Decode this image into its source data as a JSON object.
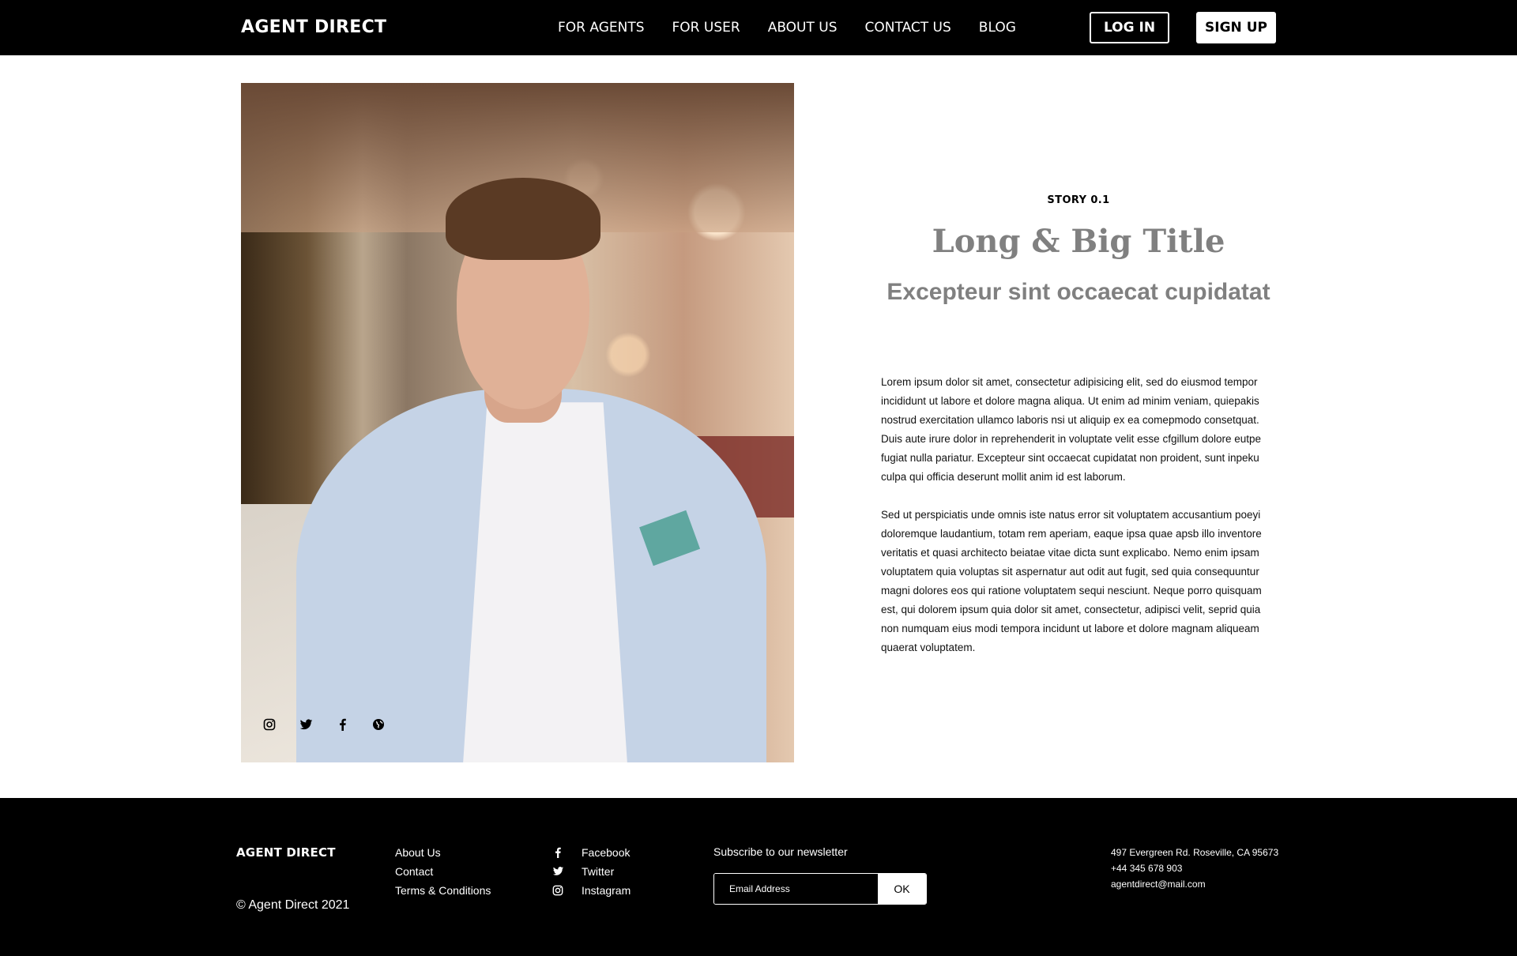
{
  "nav": {
    "brand": "AGENT DIRECT",
    "links": [
      "FOR AGENTS",
      "FOR USER",
      "ABOUT US",
      "CONTACT US",
      "BLOG"
    ],
    "login": "LOG IN",
    "signup": "SIGN UP"
  },
  "hero": {
    "social_icons": [
      "instagram-icon",
      "twitter-icon",
      "facebook-icon",
      "globe-icon"
    ]
  },
  "story": {
    "kicker": "STORY 0.1",
    "title": "Long & Big Title",
    "subtitle": "Excepteur sint occaecat cupidatat",
    "paragraphs": [
      "Lorem ipsum dolor sit amet, consectetur adipisicing elit, sed do eiusmod tempor incididunt ut labore et dolore magna aliqua. Ut enim ad minim veniam, quiepakis nostrud exercitation ullamco laboris nsi ut aliquip ex ea comepmodo consetquat. Duis aute irure dolor in reprehenderit in voluptate velit esse cfgillum dolore eutpe fugiat nulla pariatur. Excepteur sint occaecat cupidatat non proident, sunt inpeku culpa qui officia deserunt mollit anim id est laborum.",
      "Sed ut perspiciatis unde omnis iste natus error sit voluptatem accusantium poeyi doloremque laudantium, totam rem aperiam, eaque ipsa quae apsb illo inventore veritatis et quasi architecto beiatae vitae dicta sunt explicabo. Nemo enim ipsam voluptatem quia voluptas sit aspernatur aut odit aut fugit, sed quia consequuntur magni dolores eos qui ratione voluptatem sequi nesciunt. Neque porro quisquam est, qui dolorem ipsum quia dolor sit amet, consectetur, adipisci velit, seprid quia non numquam eius modi tempora incidunt ut labore et dolore magnam aliqueam quaerat voluptatem."
    ]
  },
  "footer": {
    "brand": "AGENT DIRECT",
    "copyright": "© Agent Direct 2021",
    "links": [
      "About Us",
      "Contact",
      "Terms & Conditions"
    ],
    "social": [
      {
        "label": "Facebook",
        "icon": "facebook-icon"
      },
      {
        "label": "Twitter",
        "icon": "twitter-icon"
      },
      {
        "label": "Instagram",
        "icon": "instagram-icon"
      }
    ],
    "newsletter_label": "Subscribe to our newsletter",
    "newsletter_placeholder": "Email Address",
    "newsletter_button": "OK",
    "address": "497 Evergreen Rd. Roseville, CA 95673",
    "phone": "+44 345 678 903",
    "email": "agentdirect@mail.com"
  }
}
